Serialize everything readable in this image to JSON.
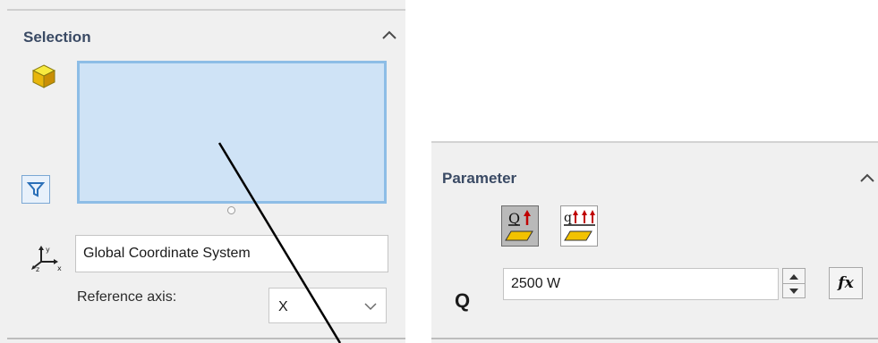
{
  "selection_panel": {
    "title": "Selection",
    "coordinate_system": "Global Coordinate System",
    "reference_axis_label": "Reference axis:",
    "reference_axis_value": "X",
    "icons": [
      "component-cube-icon",
      "filter-icon",
      "coordinate-axes-icon",
      "chevron-up-icon"
    ]
  },
  "parameter_panel": {
    "title": "Parameter",
    "mode_buttons": [
      {
        "name": "total-heat-power",
        "glyph": "Q",
        "selected": true
      },
      {
        "name": "heat-per-unit",
        "glyph": "q",
        "selected": false
      }
    ],
    "q_label": "Q",
    "q_value": "2500 W",
    "fx_label": "fx"
  },
  "colors": {
    "panel_bg": "#f0f0f0",
    "selection_fill": "#cfe3f6",
    "selection_border": "#8dbde6",
    "header_text": "#3a4a64"
  }
}
